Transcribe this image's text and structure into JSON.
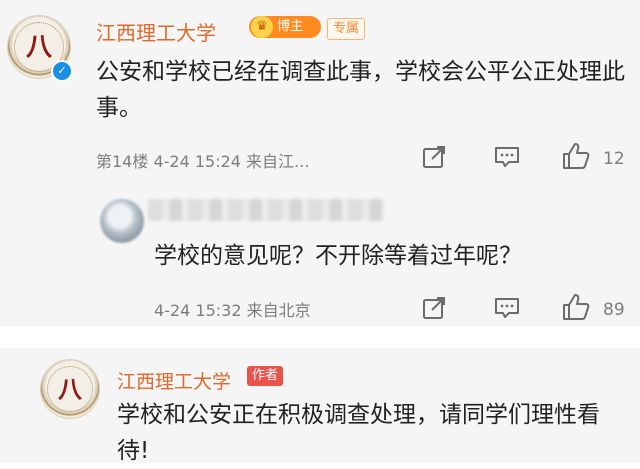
{
  "post1": {
    "author": "江西理工大学",
    "badge": "博主",
    "tag": "专属",
    "text": "公安和学校已经在调查此事，学校会公平公正处理此事。",
    "meta": "第14楼  4-24 15:24  来自江...",
    "like_count": "12",
    "icons": [
      "university-seal-avatar",
      "verified-icon",
      "crown-icon",
      "share-icon",
      "comment-icon",
      "thumbs-up-icon"
    ]
  },
  "reply": {
    "text": "学校的意见呢？不开除等着过年呢？",
    "meta": "4-24 15:32  来自北京",
    "like_count": "89"
  },
  "post2": {
    "author": "江西理工大学",
    "tag": "作者",
    "text": "学校和公安正在积极调查处理，请同学们理性看待!"
  },
  "colors": {
    "author": "#e0692b",
    "card_bg": "#f5f5f5",
    "verified": "#1b8fe6",
    "badge": "#ff8a1f",
    "author_tag": "#e8534a"
  }
}
